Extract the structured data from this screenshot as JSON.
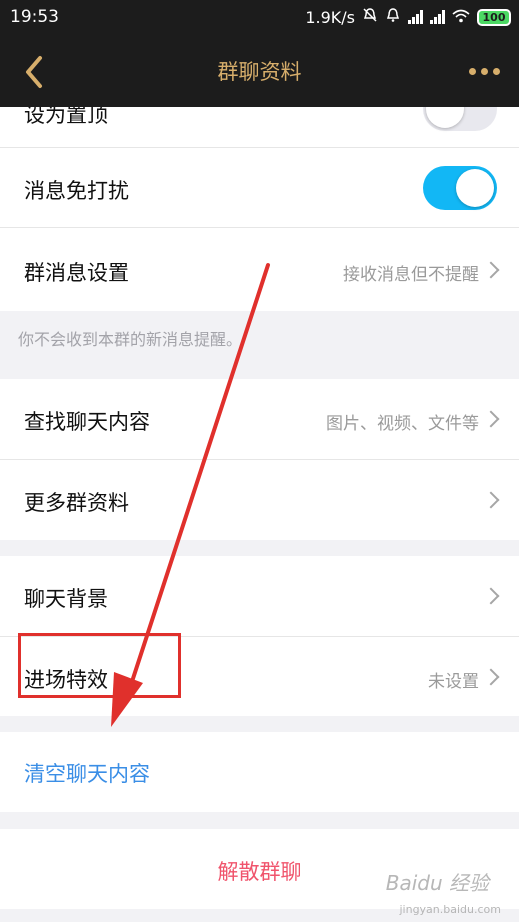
{
  "status_bar": {
    "time": "19:53",
    "net_speed": "1.9K/s",
    "battery": "100"
  },
  "nav": {
    "title": "群聊资料",
    "back_icon": "chevron-left-icon",
    "more_icon": "more-dots-icon",
    "accent_color": "#d7ae6b"
  },
  "settings": {
    "pin_top": {
      "label": "设为置顶",
      "enabled": false
    },
    "do_not_disturb": {
      "label": "消息免打扰",
      "enabled": true
    },
    "message_setting": {
      "label": "群消息设置",
      "value": "接收消息但不提醒"
    },
    "note": "你不会收到本群的新消息提醒。",
    "search_history": {
      "label": "查找聊天内容",
      "value": "图片、视频、文件等"
    },
    "more_info": {
      "label": "更多群资料"
    },
    "chat_background": {
      "label": "聊天背景"
    },
    "entry_effect": {
      "label": "进场特效",
      "value": "未设置"
    },
    "clear_history": {
      "label": "清空聊天内容"
    },
    "dissolve": {
      "label": "解散群聊"
    }
  },
  "colors": {
    "toggle_on": "#12b7f5",
    "clear_text": "#3a8ee6",
    "dissolve_text": "#f0546c",
    "annotation": "#e0302c"
  },
  "watermark": {
    "text": "Baidu 经验",
    "sub": "jingyan.baidu.com"
  }
}
